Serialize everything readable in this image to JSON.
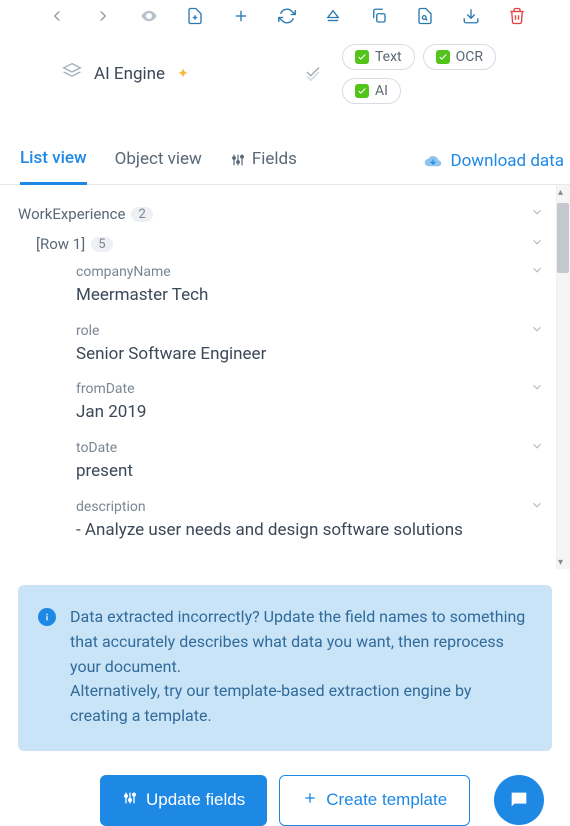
{
  "engine": {
    "label": "AI Engine"
  },
  "badges": {
    "text": "Text",
    "ocr": "OCR",
    "ai": "AI"
  },
  "tabs": {
    "list": "List view",
    "object": "Object view",
    "fields": "Fields"
  },
  "download": "Download data",
  "fields": {
    "workExperience": {
      "label": "WorkExperience",
      "count": "2"
    },
    "row1": {
      "label": "[Row 1]",
      "count": "5"
    },
    "companyName": {
      "label": "companyName",
      "value": "Meermaster Tech"
    },
    "role": {
      "label": "role",
      "value": "Senior Software Engineer"
    },
    "fromDate": {
      "label": "fromDate",
      "value": "Jan 2019"
    },
    "toDate": {
      "label": "toDate",
      "value": "present"
    },
    "description": {
      "label": "description",
      "value": "- Analyze user needs and design software solutions"
    }
  },
  "info": {
    "line1": "Data extracted incorrectly? Update the field names to something that accurately describes what data you want, then reprocess your document.",
    "line2": "Alternatively, try our template-based extraction engine by creating a template."
  },
  "buttons": {
    "update": "Update fields",
    "create": "Create template"
  }
}
